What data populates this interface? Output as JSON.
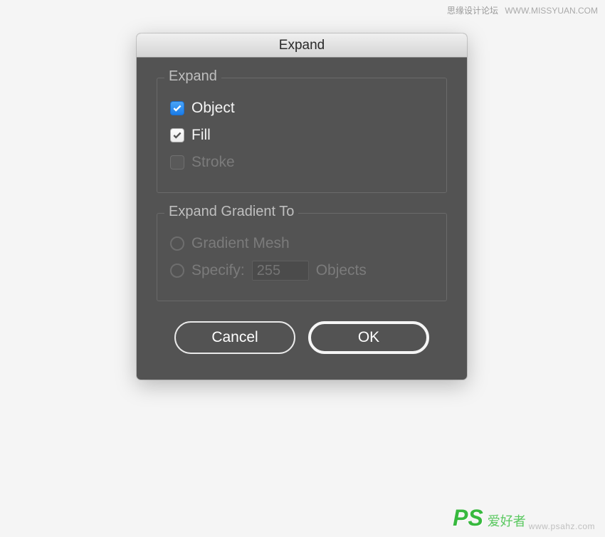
{
  "dialog": {
    "title": "Expand",
    "group_expand": {
      "legend": "Expand",
      "object_label": "Object",
      "fill_label": "Fill",
      "stroke_label": "Stroke"
    },
    "group_gradient": {
      "legend": "Expand Gradient To",
      "mesh_label": "Gradient Mesh",
      "specify_label": "Specify:",
      "specify_value": "255",
      "specify_suffix": "Objects"
    },
    "buttons": {
      "cancel": "Cancel",
      "ok": "OK"
    }
  },
  "watermarks": {
    "top_cn": "思缘设计论坛",
    "top_url": "WWW.MISSYUAN.COM",
    "bottom_ps": "PS",
    "bottom_cn": "爱好者",
    "bottom_url": "www.psahz.com"
  }
}
